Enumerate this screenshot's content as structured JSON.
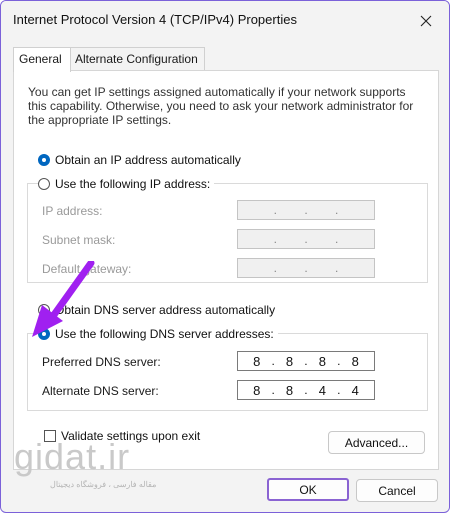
{
  "window": {
    "title": "Internet Protocol Version 4 (TCP/IPv4) Properties"
  },
  "tabs": [
    {
      "label": "General",
      "active": true
    },
    {
      "label": "Alternate Configuration",
      "active": false
    }
  ],
  "intro_text": "You can get IP settings assigned automatically if your network supports this capability. Otherwise, you need to ask your network administrator for the appropriate IP settings.",
  "ip_mode": {
    "auto_label": "Obtain an IP address automatically",
    "auto_selected": true,
    "manual_label": "Use the following IP address:",
    "manual_selected": false
  },
  "ip_fields": [
    {
      "label": "IP address:",
      "value": ". . ."
    },
    {
      "label": "Subnet mask:",
      "value": ". . ."
    },
    {
      "label": "Default gateway:",
      "value": ". . ."
    }
  ],
  "dns_mode": {
    "auto_label": "Obtain DNS server address automatically",
    "auto_selected": false,
    "manual_label": "Use the following DNS server addresses:",
    "manual_selected": true
  },
  "dns_fields": [
    {
      "label": "Preferred DNS server:",
      "octets": [
        "8",
        "8",
        "8",
        "8"
      ]
    },
    {
      "label": "Alternate DNS server:",
      "octets": [
        "8",
        "8",
        "4",
        "4"
      ]
    }
  ],
  "validate": {
    "label": "Validate settings upon exit",
    "checked": false
  },
  "buttons": {
    "advanced": "Advanced...",
    "ok": "OK",
    "cancel": "Cancel"
  },
  "watermark": {
    "logo": "gidat.ir",
    "tagline": "مقاله فارسی ، فروشگاه دیجیتال"
  },
  "colors": {
    "accent": "#0067c0",
    "annotation_arrow": "#a020f0",
    "ok_highlight": "#8a63d2"
  },
  "icons": {
    "close": "close-icon",
    "annotation": "arrow-annotation-icon"
  }
}
